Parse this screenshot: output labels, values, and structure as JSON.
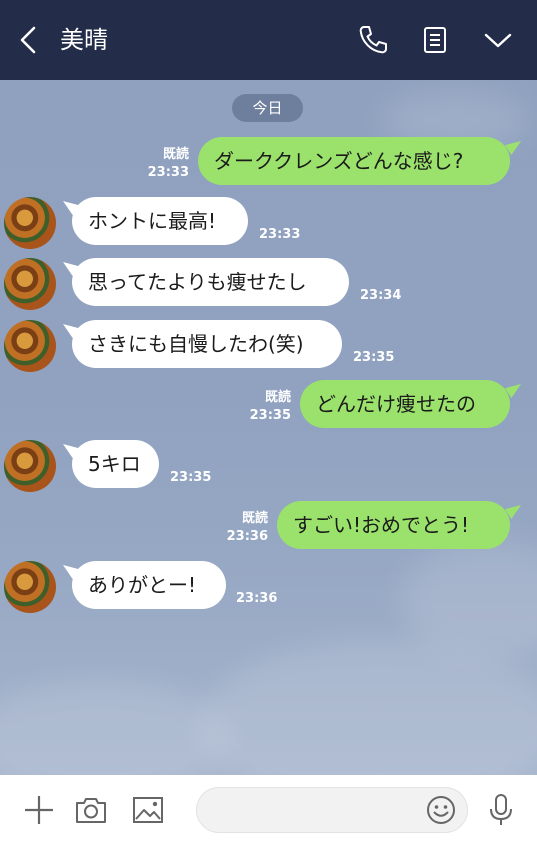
{
  "header": {
    "title": "美晴"
  },
  "chat": {
    "date_chip": "今日",
    "messages": [
      {
        "side": "out",
        "text": "ダーククレンズどんな感じ?",
        "read": "既読",
        "time": "23:33"
      },
      {
        "side": "in",
        "text": "ホントに最高!",
        "time": "23:33"
      },
      {
        "side": "in",
        "text": "思ってたよりも痩せたし",
        "time": "23:34"
      },
      {
        "side": "in",
        "text": "さきにも自慢したわ(笑)",
        "time": "23:35"
      },
      {
        "side": "out",
        "text": "どんだけ痩せたの",
        "read": "既読",
        "time": "23:35"
      },
      {
        "side": "in",
        "text": "5キロ",
        "time": "23:35"
      },
      {
        "side": "out",
        "text": "すごい!おめでとう!",
        "read": "既読",
        "time": "23:36"
      },
      {
        "side": "in",
        "text": "ありがとー!",
        "time": "23:36"
      }
    ]
  },
  "icons": {
    "header": [
      "back-icon",
      "phone-icon",
      "notes-icon",
      "chevron-down-icon"
    ],
    "footer": [
      "plus-icon",
      "camera-icon",
      "image-icon",
      "smile-icon",
      "microphone-icon"
    ]
  },
  "colors": {
    "header_bg": "#232c48",
    "outgoing_bubble": "#9be26c",
    "incoming_bubble": "#ffffff",
    "chat_bg": "#90a2c0"
  }
}
